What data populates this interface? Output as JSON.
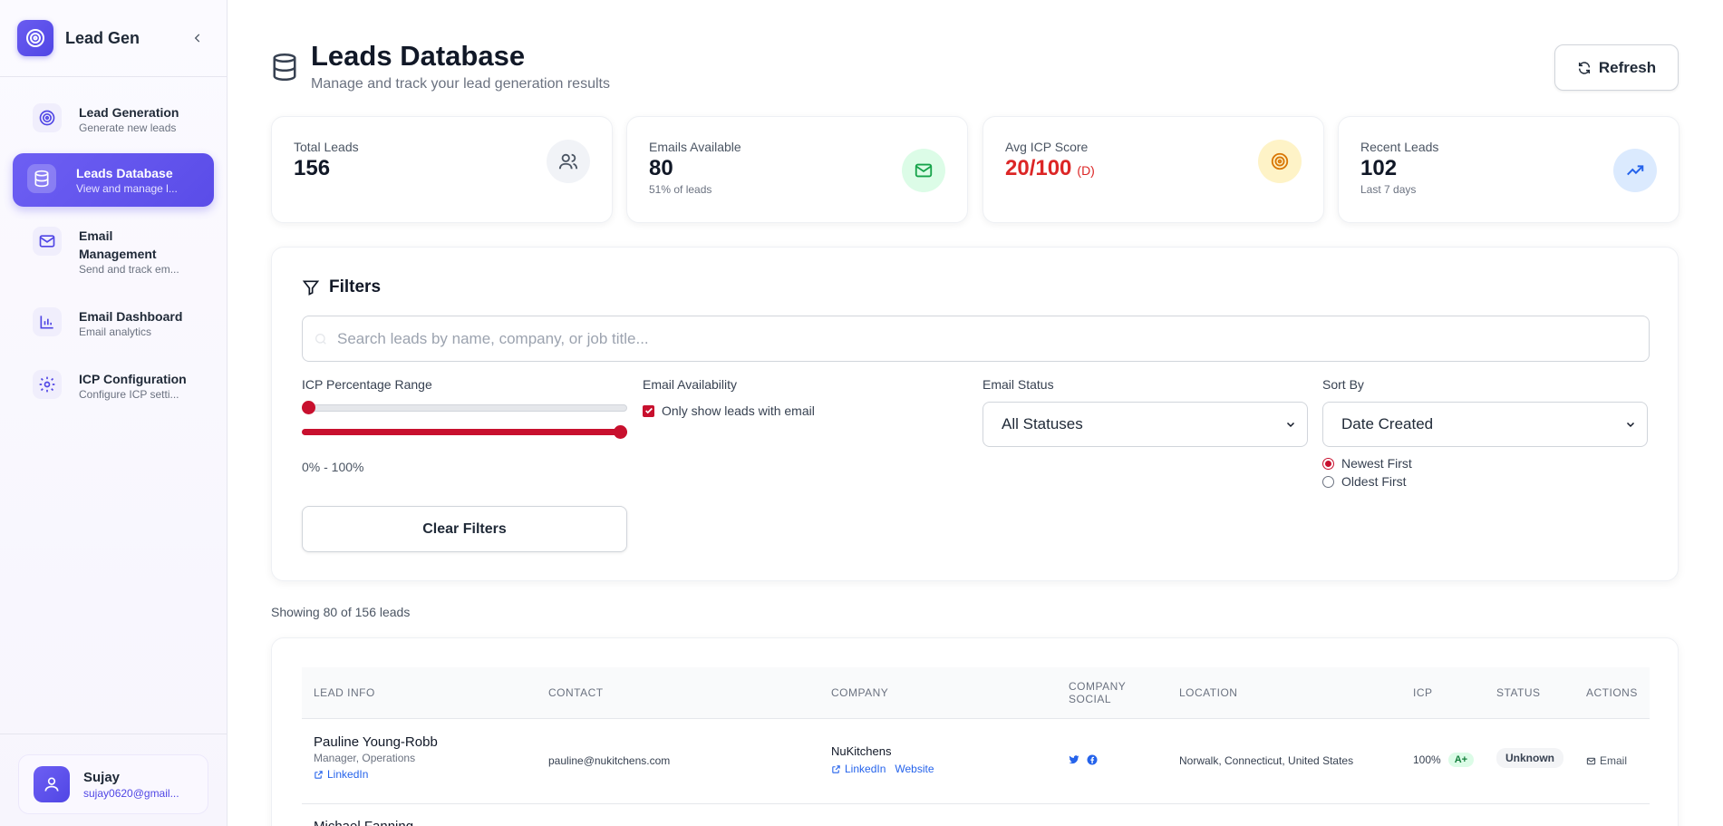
{
  "app": {
    "name": "Lead Gen"
  },
  "sidebar": {
    "items": [
      {
        "label": "Lead Generation",
        "sub": "Generate new leads",
        "icon": "target-icon"
      },
      {
        "label": "Leads Database",
        "sub": "View and manage l...",
        "icon": "database-icon",
        "active": true
      },
      {
        "label": "Email Management",
        "sub": "Send and track em...",
        "icon": "mail-icon"
      },
      {
        "label": "Email Dashboard",
        "sub": "Email analytics",
        "icon": "bar-chart-icon"
      },
      {
        "label": "ICP Configuration",
        "sub": "Configure ICP setti...",
        "icon": "gear-icon"
      }
    ],
    "user": {
      "name": "Sujay",
      "email": "sujay0620@gmail..."
    }
  },
  "header": {
    "title": "Leads Database",
    "subtitle": "Manage and track your lead generation results",
    "refresh_label": "Refresh"
  },
  "stats": [
    {
      "label": "Total Leads",
      "value": "156",
      "note": "",
      "icon": "users-icon"
    },
    {
      "label": "Emails Available",
      "value": "80",
      "note": "51% of leads",
      "icon": "mail-icon"
    },
    {
      "label": "Avg ICP Score",
      "value": "20/100",
      "grade": "(D)",
      "note": "",
      "icon": "target-icon"
    },
    {
      "label": "Recent Leads",
      "value": "102",
      "note": "Last 7 days",
      "icon": "trending-up-icon"
    }
  ],
  "filters": {
    "title": "Filters",
    "search_placeholder": "Search leads by name, company, or job title...",
    "icp_label": "ICP Percentage Range",
    "icp_min": 0,
    "icp_max": 100,
    "icp_range_text": "0% - 100%",
    "email_avail_label": "Email Availability",
    "email_only_label": "Only show leads with email",
    "email_only_checked": true,
    "email_status_label": "Email Status",
    "email_status_value": "All Statuses",
    "sort_label": "Sort By",
    "sort_value": "Date Created",
    "sort_order_options": [
      "Newest First",
      "Oldest First"
    ],
    "sort_order_selected": "Newest First",
    "clear_label": "Clear Filters"
  },
  "showing_text": "Showing 80 of 156 leads",
  "table": {
    "columns": [
      "LEAD INFO",
      "CONTACT",
      "COMPANY",
      "COMPANY SOCIAL",
      "LOCATION",
      "ICP",
      "STATUS",
      "ACTIONS"
    ],
    "rows": [
      {
        "name": "Pauline Young-Robb",
        "title": "Manager, Operations",
        "linkedin": "LinkedIn",
        "email": "pauline@nukitchens.com",
        "company": "NuKitchens",
        "company_linkedin": "LinkedIn",
        "company_website": "Website",
        "location": "Norwalk, Connecticut, United States",
        "icp": "100%",
        "icp_grade": "A+",
        "status": "Unknown",
        "action": "Email"
      },
      {
        "name": "Michael Fanning"
      }
    ]
  },
  "colors": {
    "accent": "#5046e5",
    "danger": "#dc2626",
    "slider": "#c8102e"
  }
}
